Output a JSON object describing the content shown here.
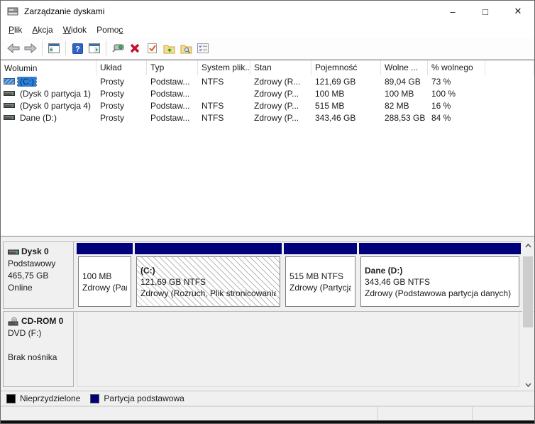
{
  "window": {
    "title": "Zarządzanie dyskami",
    "controls": {
      "minimize": "–",
      "maximize": "□",
      "close": "✕"
    }
  },
  "menu": {
    "items": [
      {
        "pre": "",
        "key": "P",
        "post": "lik"
      },
      {
        "pre": "",
        "key": "A",
        "post": "kcja"
      },
      {
        "pre": "",
        "key": "W",
        "post": "idok"
      },
      {
        "pre": "Pomo",
        "key": "c",
        "post": ""
      }
    ]
  },
  "toolbar": {
    "icons": [
      "back-icon",
      "forward-icon",
      "show-console-tree-icon",
      "help-icon",
      "show-action-pane-icon",
      "rescan-disks-icon",
      "delete-volume-icon",
      "mark-partition-icon",
      "open-icon",
      "explore-icon",
      "properties-icon"
    ]
  },
  "volume_list": {
    "columns": [
      "Wolumin",
      "Układ",
      "Typ",
      "System plik...",
      "Stan",
      "Pojemność",
      "Wolne ...",
      "% wolnego"
    ],
    "rows": [
      {
        "volume": "(C:)",
        "layout": "Prosty",
        "type": "Podstaw...",
        "fs": "NTFS",
        "status": "Zdrowy (R...",
        "capacity": "121,69 GB",
        "free": "89,04 GB",
        "pct_free": "73 %",
        "selected": true
      },
      {
        "volume": "(Dysk 0 partycja 1)",
        "layout": "Prosty",
        "type": "Podstaw...",
        "fs": "",
        "status": "Zdrowy (P...",
        "capacity": "100 MB",
        "free": "100 MB",
        "pct_free": "100 %",
        "selected": false
      },
      {
        "volume": "(Dysk 0 partycja 4)",
        "layout": "Prosty",
        "type": "Podstaw...",
        "fs": "NTFS",
        "status": "Zdrowy (P...",
        "capacity": "515 MB",
        "free": "82 MB",
        "pct_free": "16 %",
        "selected": false
      },
      {
        "volume": "Dane (D:)",
        "layout": "Prosty",
        "type": "Podstaw...",
        "fs": "NTFS",
        "status": "Zdrowy (P...",
        "capacity": "343,46 GB",
        "free": "288,53 GB",
        "pct_free": "84 %",
        "selected": false
      }
    ]
  },
  "disks": {
    "disk0": {
      "name": "Dysk 0",
      "type": "Podstawowy",
      "size": "465,75 GB",
      "status": "Online",
      "partitions": [
        {
          "line1": "",
          "line2": "100 MB",
          "line3": "Zdrowy (Par",
          "selected": false
        },
        {
          "line1": "(C:)",
          "line2": "121,69 GB NTFS",
          "line3": "Zdrowy (Rozruch, Plik stronicowania",
          "selected": true
        },
        {
          "line1": "",
          "line2": "515 MB NTFS",
          "line3": "Zdrowy (Partycja (",
          "selected": false
        },
        {
          "line1": "Dane  (D:)",
          "line2": "343,46 GB NTFS",
          "line3": "Zdrowy (Podstawowa partycja danych)",
          "selected": false
        }
      ]
    },
    "cdrom0": {
      "name": "CD-ROM 0",
      "drive": "DVD (F:)",
      "status": "Brak nośnika"
    }
  },
  "legend": {
    "items": [
      {
        "label": "Nieprzydzielone",
        "color": "#000000"
      },
      {
        "label": "Partycja podstawowa",
        "color": "#00007b"
      }
    ]
  },
  "colors": {
    "partition_bar": "#00007b",
    "selection_fill": "#2e80d7",
    "unallocated": "#000000"
  }
}
